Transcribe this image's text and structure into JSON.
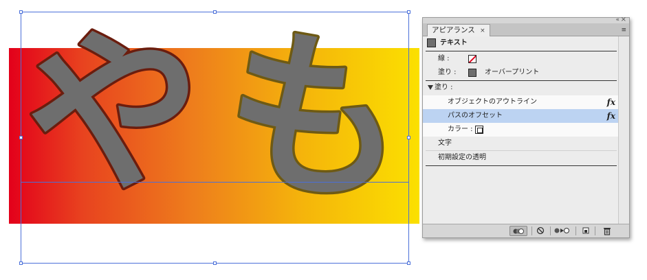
{
  "artwork": {
    "text": "やも",
    "glyphs": [
      "や",
      "も"
    ],
    "fill_color": "#6e6e6e",
    "stroke_colors": [
      "#6b1d0e",
      "#6e5a14"
    ],
    "gradient_colors": [
      "#e3001b",
      "#ee7e1c",
      "#fbe000"
    ],
    "selection_color": "#4a6fd9"
  },
  "panel": {
    "tab_title": "アピアランス",
    "tab_close": "×",
    "collapse_icon": "«",
    "close_icon": "×",
    "menu_icon": "≡",
    "header": {
      "label": "テキスト"
    },
    "rows": {
      "stroke": {
        "label": "線 :"
      },
      "fill": {
        "label": "塗り :",
        "value": "オーバープリント"
      },
      "fill_group": {
        "label": "塗り :"
      },
      "outline_effect": {
        "label": "オブジェクトのアウトライン",
        "fx": "fx"
      },
      "offset_effect": {
        "label": "パスのオフセット",
        "fx": "fx"
      },
      "color": {
        "label": "カラー :"
      },
      "characters": {
        "label": "文字"
      },
      "opacity": {
        "label": "初期設定の透明"
      }
    },
    "selected_color": "#bcd3f2",
    "toolbar_icons": [
      "show-thumbnails-icon",
      "clear-appearance-icon",
      "reduce-to-basic-icon",
      "duplicate-item-icon",
      "delete-item-icon"
    ]
  }
}
